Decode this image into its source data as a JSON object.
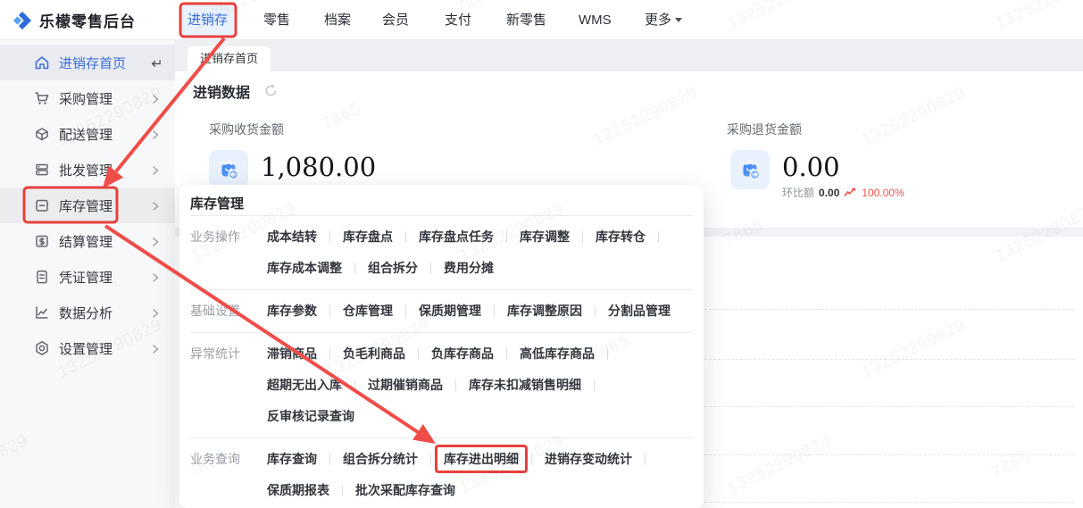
{
  "brand": {
    "logo_text": "乐檬零售后台"
  },
  "topnav": {
    "items": [
      "进销存",
      "零售",
      "档案",
      "会员",
      "支付",
      "新零售",
      "WMS",
      "更多"
    ],
    "active": "进销存"
  },
  "sidebar": {
    "items": [
      {
        "label": "进销存首页",
        "icon": "home-icon",
        "state": "active"
      },
      {
        "label": "采购管理",
        "icon": "cart-icon",
        "state": "normal"
      },
      {
        "label": "配送管理",
        "icon": "package-icon",
        "state": "normal"
      },
      {
        "label": "批发管理",
        "icon": "server-icon",
        "state": "normal"
      },
      {
        "label": "库存管理",
        "icon": "inventory-box-icon",
        "state": "hovered"
      },
      {
        "label": "结算管理",
        "icon": "dollar-square-icon",
        "state": "normal"
      },
      {
        "label": "凭证管理",
        "icon": "document-icon",
        "state": "normal"
      },
      {
        "label": "数据分析",
        "icon": "chart-line-icon",
        "state": "normal"
      },
      {
        "label": "设置管理",
        "icon": "gear-icon",
        "state": "normal"
      }
    ]
  },
  "tabs": {
    "active": "进销存首页"
  },
  "dashboard": {
    "section_title": "进销数据",
    "stats": [
      {
        "label": "采购收货金额",
        "value": "1,080.00"
      },
      {
        "label": "采购退货金额",
        "value": "0.00",
        "compare_label": "环比额",
        "compare_value": "0.00",
        "compare_pct": "100.00%"
      }
    ]
  },
  "popup": {
    "title": "库存管理",
    "sections": [
      {
        "label": "业务操作",
        "lines": [
          [
            "成本结转",
            "库存盘点",
            "库存盘点任务",
            "库存调整",
            "库存转仓"
          ],
          [
            "库存成本调整",
            "组合拆分",
            "费用分摊"
          ]
        ]
      },
      {
        "label": "基础设置",
        "lines": [
          [
            "库存参数",
            "仓库管理",
            "保质期管理",
            "库存调整原因",
            "分割品管理"
          ]
        ]
      },
      {
        "label": "异常统计",
        "lines": [
          [
            "滞销商品",
            "负毛利商品",
            "负库存商品",
            "高低库存商品"
          ],
          [
            "超期无出入库",
            "过期催销商品",
            "库存未扣减销售明细"
          ],
          [
            "反审核记录查询"
          ]
        ]
      },
      {
        "label": "业务查询",
        "lines": [
          [
            "库存查询",
            "组合拆分统计",
            "库存进出明细",
            "进销存变动统计"
          ],
          [
            "保质期报表",
            "批次采配库存查询"
          ]
        ]
      }
    ],
    "highlighted_item": "库存进出明细"
  },
  "watermark": {
    "text": "13252290829",
    "text2": "7865"
  },
  "colors": {
    "accent_blue": "#3a6ed8",
    "annotation_red": "#e8403d",
    "pct_red": "#f3504c",
    "active_chip_bg": "#e8f1fc"
  }
}
